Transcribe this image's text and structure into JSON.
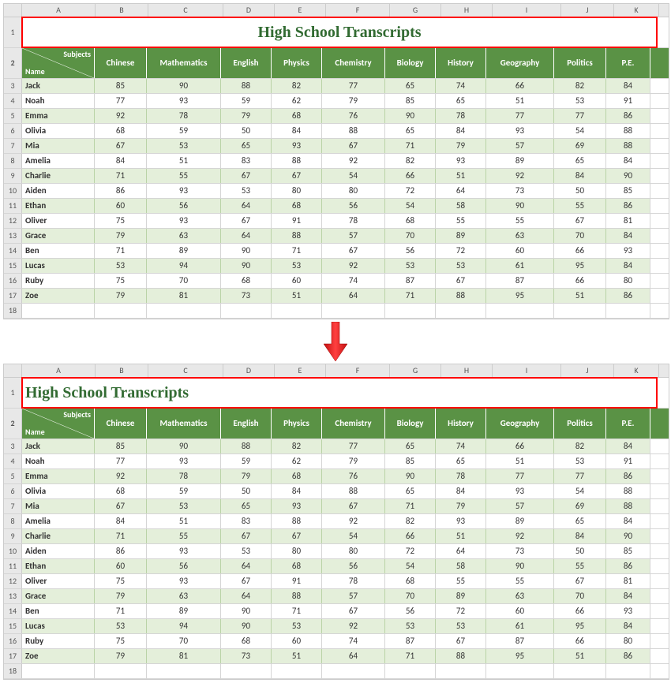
{
  "title": "High School Transcripts",
  "corner": {
    "subjects": "Subjects",
    "name": "Name"
  },
  "columns_letters": [
    "A",
    "B",
    "C",
    "D",
    "E",
    "F",
    "G",
    "H",
    "I",
    "J",
    "K"
  ],
  "row_numbers": [
    1,
    2,
    3,
    4,
    5,
    6,
    7,
    8,
    9,
    10,
    11,
    12,
    13,
    14,
    15,
    16,
    17,
    18
  ],
  "headers": [
    "Chinese",
    "Mathematics",
    "English",
    "Physics",
    "Chemistry",
    "Biology",
    "History",
    "Geography",
    "Politics",
    "P.E."
  ],
  "rows": [
    {
      "name": "Jack",
      "values": [
        85,
        90,
        88,
        82,
        77,
        65,
        74,
        66,
        82,
        84
      ]
    },
    {
      "name": "Noah",
      "values": [
        77,
        93,
        59,
        62,
        79,
        85,
        65,
        51,
        53,
        91
      ]
    },
    {
      "name": "Emma",
      "values": [
        92,
        78,
        79,
        68,
        76,
        90,
        78,
        77,
        77,
        86
      ]
    },
    {
      "name": "Olivia",
      "values": [
        68,
        59,
        50,
        84,
        88,
        65,
        84,
        93,
        54,
        88
      ]
    },
    {
      "name": "Mia",
      "values": [
        67,
        53,
        65,
        93,
        67,
        71,
        79,
        57,
        69,
        88
      ]
    },
    {
      "name": "Amelia",
      "values": [
        84,
        51,
        83,
        88,
        92,
        82,
        93,
        89,
        65,
        84
      ]
    },
    {
      "name": "Charlie",
      "values": [
        71,
        55,
        67,
        67,
        54,
        66,
        51,
        92,
        84,
        90
      ]
    },
    {
      "name": "Aiden",
      "values": [
        86,
        93,
        53,
        80,
        80,
        72,
        64,
        73,
        50,
        85
      ]
    },
    {
      "name": "Ethan",
      "values": [
        60,
        56,
        64,
        68,
        56,
        54,
        58,
        90,
        55,
        86
      ]
    },
    {
      "name": "Oliver",
      "values": [
        75,
        93,
        67,
        91,
        78,
        68,
        55,
        55,
        67,
        81
      ]
    },
    {
      "name": "Grace",
      "values": [
        79,
        63,
        64,
        88,
        57,
        70,
        89,
        63,
        70,
        84
      ]
    },
    {
      "name": "Ben",
      "values": [
        71,
        89,
        90,
        71,
        67,
        56,
        72,
        60,
        66,
        93
      ]
    },
    {
      "name": "Lucas",
      "values": [
        53,
        94,
        90,
        53,
        92,
        53,
        53,
        61,
        95,
        84
      ]
    },
    {
      "name": "Ruby",
      "values": [
        75,
        70,
        68,
        60,
        74,
        87,
        67,
        87,
        66,
        80
      ]
    },
    {
      "name": "Zoe",
      "values": [
        79,
        81,
        73,
        51,
        64,
        71,
        88,
        95,
        51,
        86
      ]
    }
  ],
  "chart_data": {
    "type": "table",
    "title": "High School Transcripts",
    "columns": [
      "Name",
      "Chinese",
      "Mathematics",
      "English",
      "Physics",
      "Chemistry",
      "Biology",
      "History",
      "Geography",
      "Politics",
      "P.E."
    ],
    "data": [
      [
        "Jack",
        85,
        90,
        88,
        82,
        77,
        65,
        74,
        66,
        82,
        84
      ],
      [
        "Noah",
        77,
        93,
        59,
        62,
        79,
        85,
        65,
        51,
        53,
        91
      ],
      [
        "Emma",
        92,
        78,
        79,
        68,
        76,
        90,
        78,
        77,
        77,
        86
      ],
      [
        "Olivia",
        68,
        59,
        50,
        84,
        88,
        65,
        84,
        93,
        54,
        88
      ],
      [
        "Mia",
        67,
        53,
        65,
        93,
        67,
        71,
        79,
        57,
        69,
        88
      ],
      [
        "Amelia",
        84,
        51,
        83,
        88,
        92,
        82,
        93,
        89,
        65,
        84
      ],
      [
        "Charlie",
        71,
        55,
        67,
        67,
        54,
        66,
        51,
        92,
        84,
        90
      ],
      [
        "Aiden",
        86,
        93,
        53,
        80,
        80,
        72,
        64,
        73,
        50,
        85
      ],
      [
        "Ethan",
        60,
        56,
        64,
        68,
        56,
        54,
        58,
        90,
        55,
        86
      ],
      [
        "Oliver",
        75,
        93,
        67,
        91,
        78,
        68,
        55,
        55,
        67,
        81
      ],
      [
        "Grace",
        79,
        63,
        64,
        88,
        57,
        70,
        89,
        63,
        70,
        84
      ],
      [
        "Ben",
        71,
        89,
        90,
        71,
        67,
        56,
        72,
        60,
        66,
        93
      ],
      [
        "Lucas",
        53,
        94,
        90,
        53,
        92,
        53,
        53,
        61,
        95,
        84
      ],
      [
        "Ruby",
        75,
        70,
        68,
        60,
        74,
        87,
        67,
        87,
        66,
        80
      ],
      [
        "Zoe",
        79,
        81,
        73,
        51,
        64,
        71,
        88,
        95,
        51,
        86
      ]
    ]
  }
}
